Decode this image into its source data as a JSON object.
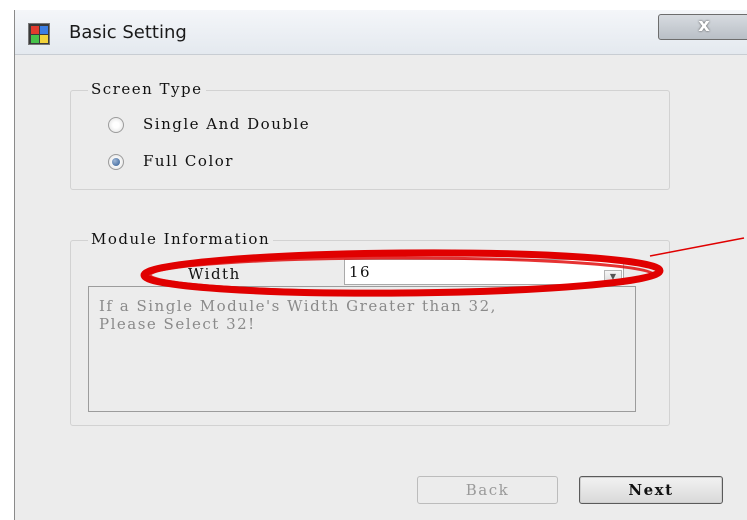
{
  "window": {
    "title": "Basic Setting",
    "close_label": "x"
  },
  "screen_type": {
    "legend": "Screen Type",
    "options": [
      {
        "label": "Single And Double",
        "selected": false
      },
      {
        "label": "Full Color",
        "selected": true
      }
    ]
  },
  "module_info": {
    "legend": "Module Information",
    "width_label": "Width",
    "width_value": "16",
    "note": "If a Single Module's Width Greater than 32, Please Select 32!"
  },
  "buttons": {
    "back": "Back",
    "next": "Next"
  },
  "annotation": {
    "ellipse_color": "#e00000",
    "pointer_color": "#e00000"
  }
}
